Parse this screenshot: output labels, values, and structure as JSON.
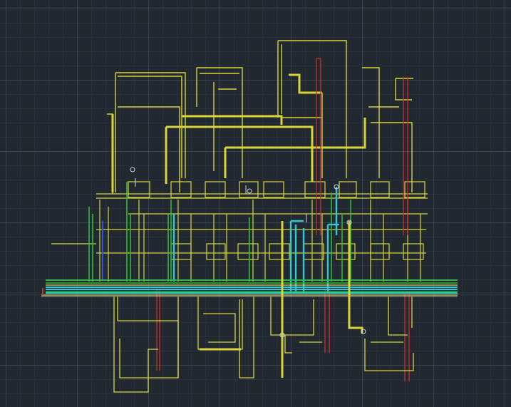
{
  "drawing": {
    "colors": {
      "background": "#212830",
      "yellow": "#d8d43a",
      "green": "#2fb83c",
      "cyan": "#2ec8d6",
      "red": "#c8302a",
      "white": "#cfd4dc",
      "blue": "#3a52d8"
    }
  }
}
